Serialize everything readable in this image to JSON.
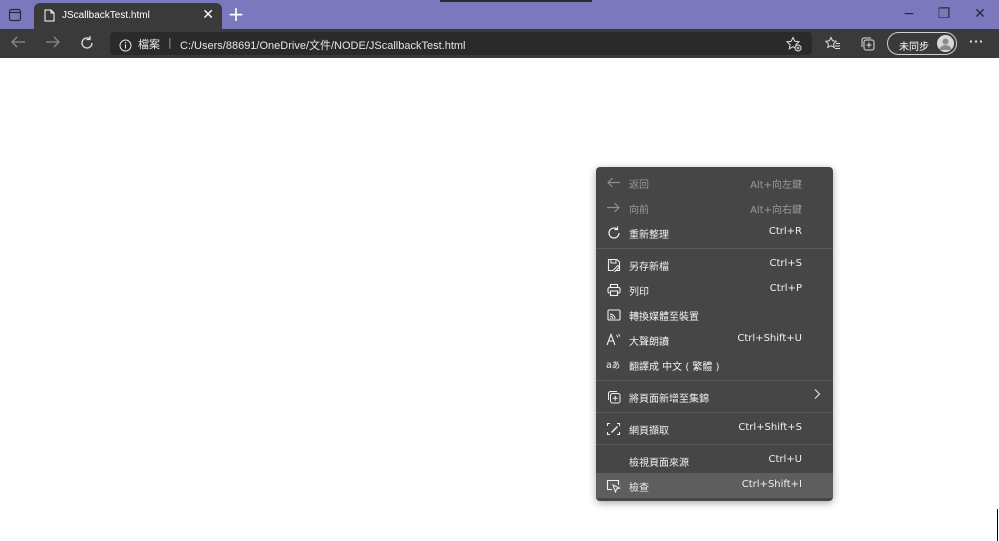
{
  "browser": {
    "tab": {
      "title": "JScallbackTest.html",
      "close_label": "✕"
    },
    "new_tab_label": "+",
    "window": {
      "minimize": "−",
      "restore": "❐",
      "close": "✕"
    },
    "address": {
      "site_label": "檔案",
      "separator": "|",
      "url": "C:/Users/88691/OneDrive/文件/NODE/JScallbackTest.html"
    },
    "profile": {
      "label": "未同步"
    },
    "more_label": "···"
  },
  "context_menu": {
    "items": [
      {
        "label": "返回",
        "shortcut": "Alt+向左鍵",
        "icon": "back-arrow-icon",
        "disabled": true
      },
      {
        "label": "向前",
        "shortcut": "Alt+向右鍵",
        "icon": "forward-arrow-icon",
        "disabled": true
      },
      {
        "label": "重新整理",
        "shortcut": "Ctrl+R",
        "icon": "refresh-icon",
        "disabled": false
      },
      {
        "label": "另存新檔",
        "shortcut": "Ctrl+S",
        "icon": "save-as-icon",
        "disabled": false
      },
      {
        "label": "列印",
        "shortcut": "Ctrl+P",
        "icon": "printer-icon",
        "disabled": false
      },
      {
        "label": "轉換媒體至裝置",
        "shortcut": "",
        "icon": "cast-icon",
        "disabled": false
      },
      {
        "label": "大聲朗讀",
        "shortcut": "Ctrl+Shift+U",
        "icon": "read-aloud-icon",
        "disabled": false
      },
      {
        "label": "翻譯成 中文 ( 繁體 )",
        "shortcut": "",
        "icon": "translate-icon",
        "disabled": false
      },
      {
        "label": "將頁面新增至集錦",
        "shortcut": "",
        "icon": "collections-icon",
        "disabled": false
      },
      {
        "label": "網頁擷取",
        "shortcut": "Ctrl+Shift+S",
        "icon": "web-capture-icon",
        "disabled": false
      },
      {
        "label": "檢視頁面來源",
        "shortcut": "Ctrl+U",
        "icon": "",
        "disabled": false
      },
      {
        "label": "檢查",
        "shortcut": "Ctrl+Shift+I",
        "icon": "inspect-icon",
        "disabled": false,
        "highlighted": true
      }
    ]
  }
}
